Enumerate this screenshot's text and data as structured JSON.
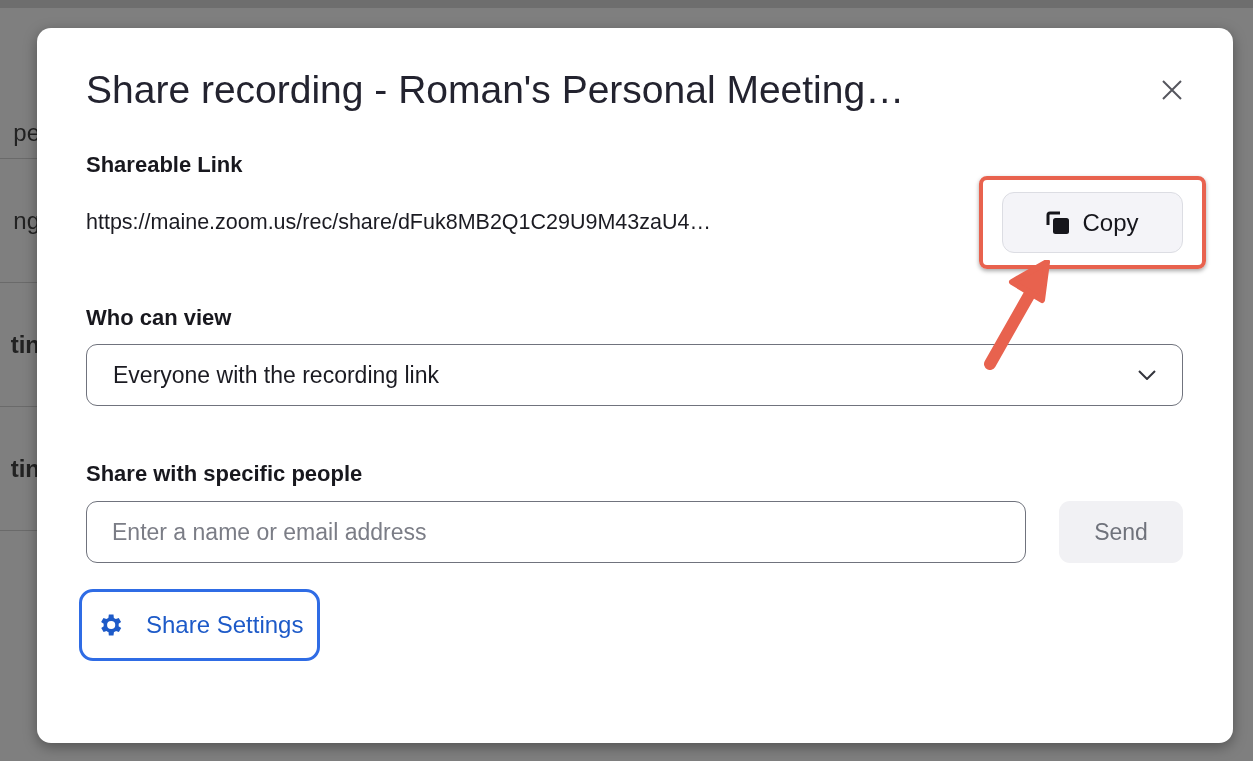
{
  "background": {
    "fragments": [
      "pe",
      "ng",
      "tin",
      "tin"
    ]
  },
  "dialog": {
    "title": "Share recording - Roman's Personal Meeting…",
    "link_label": "Shareable Link",
    "link": "https://maine.zoom.us/rec/share/dFuk8MB2Q1C29U9M43zaU4…",
    "copy_button": "Copy",
    "view_label": "Who can view",
    "view_select": "Everyone with the recording link",
    "people_label": "Share with specific people",
    "people_input": {
      "placeholder": "Enter a name or email address"
    },
    "send_button": {
      "label": "Send",
      "disabled": true
    },
    "settings_button": "Share Settings"
  }
}
